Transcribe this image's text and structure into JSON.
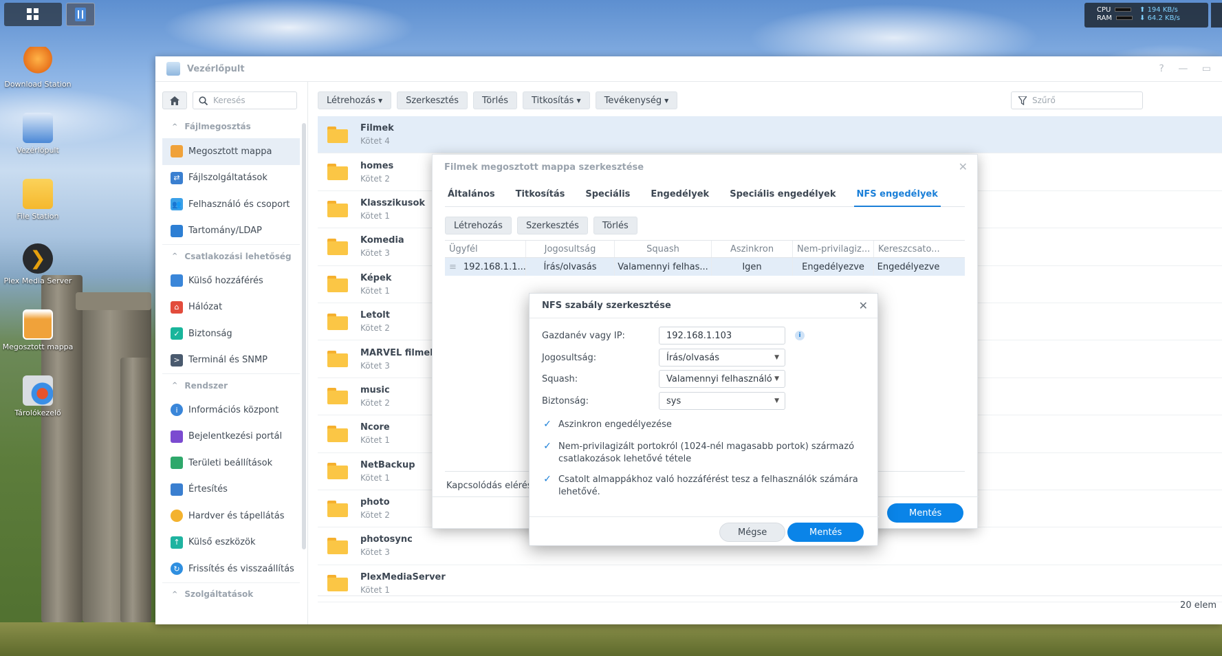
{
  "taskbar": {
    "cpu_label": "CPU",
    "ram_label": "RAM",
    "upload_rate": "194 KB/s",
    "download_rate": "64.2 KB/s"
  },
  "desktop_icons": [
    {
      "label": "Download Station",
      "icon": "download-icon",
      "color": "#e8731c"
    },
    {
      "label": "Vezérlőpult",
      "icon": "control-panel-icon",
      "color": "#4a88d6"
    },
    {
      "label": "File Station",
      "icon": "folder-icon",
      "color": "#f5b82e"
    },
    {
      "label": "Plex Media Server",
      "icon": "plex-icon",
      "color": "#282a2d"
    },
    {
      "label": "Megosztott mappa",
      "icon": "shared-folder-icon",
      "color": "#f0a23a"
    },
    {
      "label": "Tárolókezelő",
      "icon": "storage-manager-icon",
      "color": "#3a8ee6"
    }
  ],
  "window": {
    "title": "Vezérlőpult",
    "help": "?",
    "minimize": "—",
    "maximize": "▭"
  },
  "sidebar": {
    "search_placeholder": "Keresés",
    "sections": [
      {
        "title": "Fájlmegosztás",
        "items": [
          "Megosztott mappa",
          "Fájlszolgáltatások",
          "Felhasználó és csoport",
          "Tartomány/LDAP"
        ]
      },
      {
        "title": "Csatlakozási lehetőség",
        "items": [
          "Külső hozzáférés",
          "Hálózat",
          "Biztonság",
          "Terminál és SNMP"
        ]
      },
      {
        "title": "Rendszer",
        "items": [
          "Információs központ",
          "Bejelentkezési portál",
          "Területi beállítások",
          "Értesítés",
          "Hardver és tápellátás",
          "Külső eszközök",
          "Frissítés és visszaállítás"
        ]
      },
      {
        "title": "Szolgáltatások",
        "items": []
      }
    ]
  },
  "toolbar": {
    "create": "Létrehozás",
    "edit": "Szerkesztés",
    "delete": "Törlés",
    "encrypt": "Titkosítás",
    "action": "Tevékenység",
    "filter_placeholder": "Szűrő"
  },
  "folders": [
    {
      "name": "Filmek",
      "volume": "Kötet 4"
    },
    {
      "name": "homes",
      "volume": "Kötet 2"
    },
    {
      "name": "Klasszikusok",
      "volume": "Kötet 1"
    },
    {
      "name": "Komedia",
      "volume": "Kötet 3"
    },
    {
      "name": "Képek",
      "volume": "Kötet 1"
    },
    {
      "name": "Letolt",
      "volume": "Kötet 2"
    },
    {
      "name": "MARVEL filmek",
      "volume": "Kötet 3"
    },
    {
      "name": "music",
      "volume": "Kötet 2"
    },
    {
      "name": "Ncore",
      "volume": "Kötet 1"
    },
    {
      "name": "NetBackup",
      "volume": "Kötet 1"
    },
    {
      "name": "photo",
      "volume": "Kötet 2"
    },
    {
      "name": "photosync",
      "volume": "Kötet 3"
    },
    {
      "name": "PlexMediaServer",
      "volume": "Kötet 1"
    }
  ],
  "item_count": "20 elem",
  "edit_dialog": {
    "title": "Filmek megosztott mappa szerkesztése",
    "tabs": [
      "Általános",
      "Titkosítás",
      "Speciális",
      "Engedélyek",
      "Speciális engedélyek",
      "NFS engedélyek"
    ],
    "active_tab": "NFS engedélyek",
    "buttons": {
      "create": "Létrehozás",
      "edit": "Szerkesztés",
      "delete": "Törlés"
    },
    "columns": [
      "Ügyfél",
      "Jogosultság",
      "Squash",
      "Aszinkron",
      "Nem-privilagiz...",
      "Kereszcsato..."
    ],
    "rows": [
      {
        "client": "192.168.1.1...",
        "privilege": "Írás/olvasás",
        "squash": "Valamennyi felhas...",
        "async": "Igen",
        "nonpriv": "Engedélyezve",
        "cross": "Engedélyezve"
      }
    ],
    "footer_text": "Kapcsolódás elérés",
    "save": "Mentés"
  },
  "nfs_dialog": {
    "title": "NFS szabály szerkesztése",
    "fields": {
      "host_label": "Gazdanév vagy IP:",
      "host_value": "192.168.1.103",
      "privilege_label": "Jogosultság:",
      "privilege_value": "Írás/olvasás",
      "squash_label": "Squash:",
      "squash_value": "Valamennyi felhasználó",
      "security_label": "Biztonság:",
      "security_value": "sys"
    },
    "checkboxes": [
      {
        "label": "Aszinkron engedélyezése",
        "checked": true
      },
      {
        "label": "Nem-privilagizált portokról (1024-nél magasabb portok) származó csatlakozások lehetővé tétele",
        "checked": true
      },
      {
        "label": "Csatolt almappákhoz való hozzáférést tesz a felhasználók számára lehetővé.",
        "checked": true
      }
    ],
    "cancel": "Mégse",
    "save": "Mentés"
  }
}
